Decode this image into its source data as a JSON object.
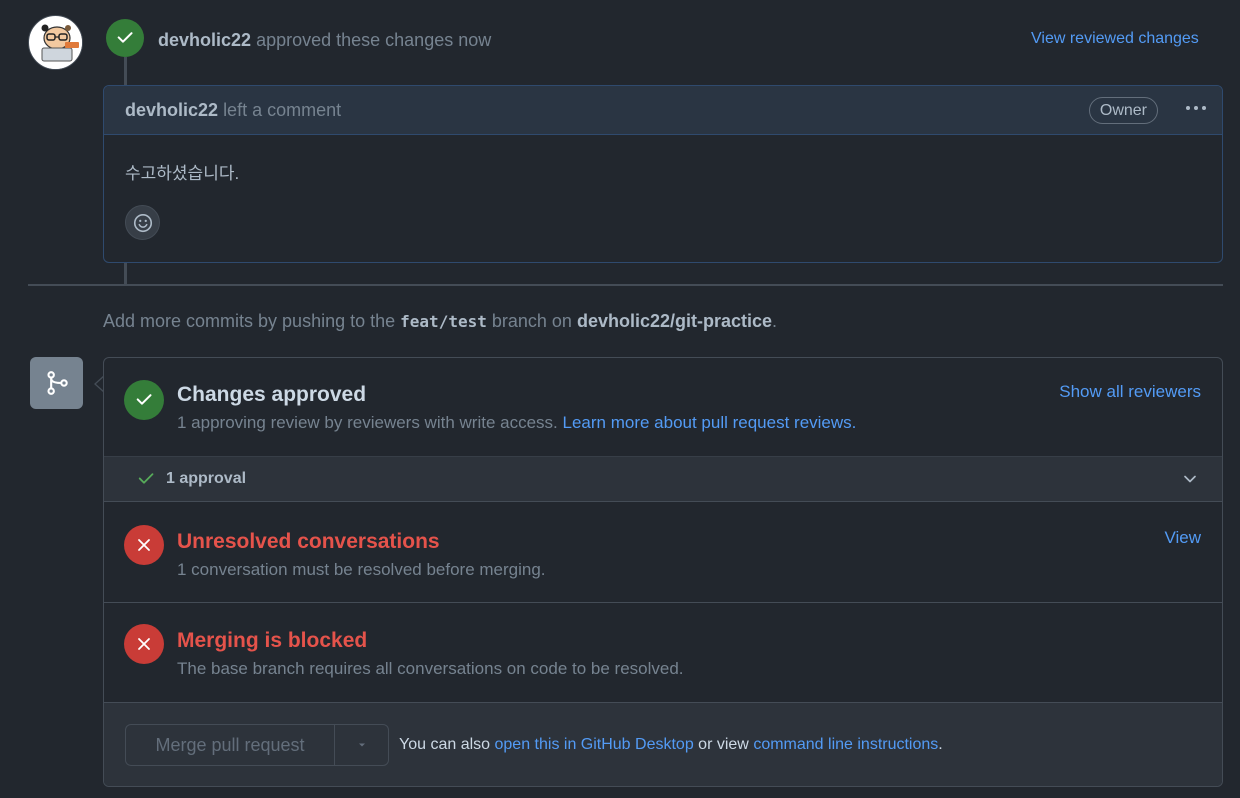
{
  "review": {
    "reviewer": "devholic22",
    "action_text": "approved these changes now",
    "view_changes_label": "View reviewed changes"
  },
  "comment": {
    "author": "devholic22",
    "action_text": "left a comment",
    "role_badge": "Owner",
    "menu_icon": "kebab-horizontal-icon",
    "body": "수고하셨습니다."
  },
  "push_hint": {
    "prefix": "Add more commits by pushing to the",
    "branch": "feat/test",
    "middle": "branch on",
    "repo": "devholic22/git-practice",
    "suffix": "."
  },
  "merge_box": {
    "changes_approved": {
      "title": "Changes approved",
      "subtitle": "1 approving review by reviewers with write access.",
      "learn_more_label": "Learn more about pull request reviews.",
      "show_reviewers_label": "Show all reviewers"
    },
    "approvals": {
      "label": "1 approval"
    },
    "unresolved": {
      "title": "Unresolved conversations",
      "subtitle": "1 conversation must be resolved before merging.",
      "view_label": "View"
    },
    "blocked": {
      "title": "Merging is blocked",
      "subtitle": "The base branch requires all conversations on code to be resolved."
    },
    "footer": {
      "merge_button_label": "Merge pull request",
      "text_prefix": "You can also",
      "desktop_link": "open this in GitHub Desktop",
      "text_middle": "or view",
      "cli_link": "command line instructions",
      "text_suffix": "."
    }
  },
  "colors": {
    "background": "#22272e",
    "success": "#347d39",
    "danger": "#c93c37",
    "danger_text": "#e5534b",
    "link": "#539bf5"
  }
}
